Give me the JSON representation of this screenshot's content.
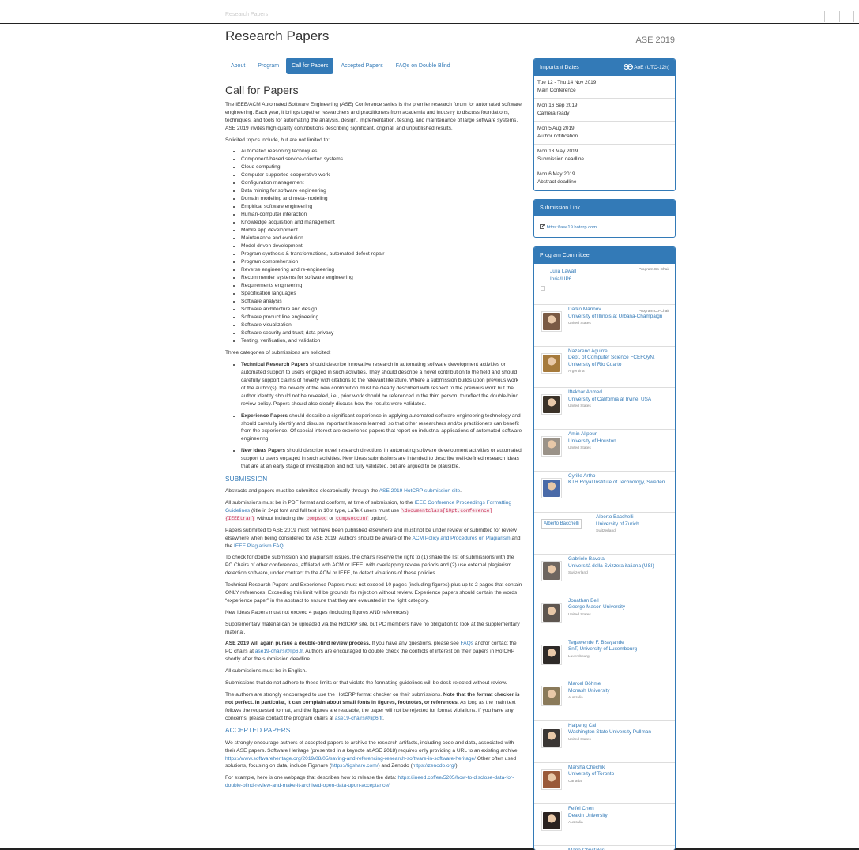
{
  "topbar": {
    "faint_text": "Research Papers"
  },
  "page": {
    "title": "Research Papers",
    "conference": "ASE 2019"
  },
  "tabs": [
    {
      "label": "About",
      "active": false
    },
    {
      "label": "Program",
      "active": false
    },
    {
      "label": "Call for Papers",
      "active": true
    },
    {
      "label": "Accepted Papers",
      "active": false
    },
    {
      "label": "FAQs on Double Blind",
      "active": false
    }
  ],
  "main": {
    "heading": "Call for Papers",
    "intro": "The IEEE/ACM Automated Software Engineering (ASE) Conference series is the premier research forum for automated software engineering. Each year, it brings together researchers and practitioners from academia and industry to discuss foundations, techniques, and tools for automating the analysis, design, implementation, testing, and maintenance of large software systems. ASE 2019 invites high quality contributions describing significant, original, and unpublished results.",
    "topics_intro": "Solicited topics include, but are not limited to:",
    "topics": [
      "Automated reasoning techniques",
      "Component-based service-oriented systems",
      "Cloud computing",
      "Computer-supported cooperative work",
      "Configuration management",
      "Data mining for software engineering",
      "Domain modeling and meta-modeling",
      "Empirical software engineering",
      "Human-computer interaction",
      "Knowledge acquisition and management",
      "Mobile app development",
      "Maintenance and evolution",
      "Model-driven development",
      "Program synthesis & transformations, automated defect repair",
      "Program comprehension",
      "Reverse engineering and re-engineering",
      "Recommender systems for software engineering",
      "Requirements engineering",
      "Specification languages",
      "Software analysis",
      "Software architecture and design",
      "Software product line engineering",
      "Software visualization",
      "Software security and trust; data privacy",
      "Testing, verification, and validation"
    ],
    "categories_intro": "Three categories of submissions are solicited:",
    "categories": [
      {
        "title": "Technical Research Papers",
        "text": " should describe innovative research in automating software development activities or automated support to users engaged in such activities. They should describe a novel contribution to the field and should carefully support claims of novelty with citations to the relevant literature. Where a submission builds upon previous work of the author(s), the novelty of the new contribution must be clearly described with respect to the previous work but the author identity should not be revealed, i.e., prior work should be referenced in the third person, to reflect the double-blind review policy. Papers should also clearly discuss how the results were validated."
      },
      {
        "title": "Experience Papers",
        "text": " should describe a significant experience in applying automated software engineering technology and should carefully identify and discuss important lessons learned, so that other researchers and/or practitioners can benefit from the experience. Of special interest are experience papers that report on industrial applications of automated software engineering."
      },
      {
        "title": "New Ideas Papers",
        "text": " should describe novel research directions in automating software development activities or automated support to users engaged in such activities. New ideas submissions are intended to describe well-defined research ideas that are at an early stage of investigation and not fully validated, but are argued to be plausible."
      }
    ],
    "submission_heading": "SUBMISSION",
    "sub_p1_pre": "Abstracts and papers must be submitted electronically through the ",
    "sub_p1_link": "ASE 2019 HotCRP submission site",
    "sub_p1_post": ".",
    "sub_p2_pre": "All submissions must be in PDF format and conform, at time of submission, to the ",
    "sub_p2_link": "IEEE Conference Proceedings Formatting Guidelines",
    "sub_p2_mid": " (title in 24pt font and full text in 10pt type, LaTeX users must use ",
    "sub_p2_code1": "\\documentclass[10pt,conference]{IEEEtran}",
    "sub_p2_mid2": " without including the ",
    "sub_p2_code2": "compsoc",
    "sub_p2_or": " or ",
    "sub_p2_code3": "compsocconf",
    "sub_p2_post": " option).",
    "sub_p3_pre": "Papers submitted to ASE 2019 must not have been published elsewhere and must not be under review or submitted for review elsewhere when being considered for ASE 2019. Authors should be aware of the ",
    "sub_p3_link1": "ACM Policy and Procedures on Plagiarism",
    "sub_p3_mid": " and the ",
    "sub_p3_link2": "IEEE Plagiarism FAQ",
    "sub_p3_post": ".",
    "sub_p4": "To check for double submission and plagiarism issues, the chairs reserve the right to (1) share the list of submissions with the PC Chairs of other conferences, affiliated with ACM or IEEE, with overlapping review periods and (2) use external plagiarism detection software, under contract to the ACM or IEEE, to detect violations of these policies.",
    "sub_p5": "Technical Research Papers and Experience Papers must not exceed 10 pages (including figures) plus up to 2 pages that contain ONLY references. Exceeding this limit will be grounds for rejection without review. Experience papers should contain the words “experience paper” in the abstract to ensure that they are evaluated in the right category.",
    "sub_p6": "New Ideas Papers must not exceed 4 pages (including figures AND references).",
    "sub_p7": "Supplementary material can be uploaded via the HotCRP site, but PC members have no obligation to look at the supplementary material.",
    "sub_p8_bold": "ASE 2019 will again pursue a double-blind review process.",
    "sub_p8_pre": " If you have any questions, please see ",
    "sub_p8_link1": "FAQs",
    "sub_p8_mid": " and/or contact the PC chairs at ",
    "sub_p8_link2": "ase19-chairs@lip6.fr",
    "sub_p8_post": ". Authors are encouraged to double check the conflicts of interest on their papers in HotCRP shortly after the submission deadline.",
    "sub_p9": "All submissions must be in English.",
    "sub_p10": "Submissions that do not adhere to these limits or that violate the formatting guidelines will be desk-rejected without review.",
    "sub_p11_pre": "The authors are strongly encouraged to use the HotCRP format checker on their submissions. ",
    "sub_p11_bold": "Note that the format checker is not perfect. In particular, it can complain about small fonts in figures, footnotes, or references.",
    "sub_p11_mid": " As long as the main text follows the requested format, and the figures are readable, the paper will not be rejected for format violations. If you have any concerns, please contact the program chairs at ",
    "sub_p11_link": "ase19-chairs@lip6.fr",
    "sub_p11_post": ".",
    "accepted_heading": "ACCEPTED PAPERS",
    "acc_p1_pre": "We strongly encourage authors of accepted papers to archive the research artifacts, including code and data, associated with their ASE papers. Software Heritage (presented in a keynote at ASE 2018) requires only providing a URL to an existing archive: ",
    "acc_p1_link1": "https://www.softwareheritage.org/2019/08/05/saving-and-referencing-research-software-in-software-heritage/",
    "acc_p1_mid": " Other often used solutions, focusing on data, include Figshare (",
    "acc_p1_link2": "https://figshare.com/",
    "acc_p1_mid2": ") and Zenodo (",
    "acc_p1_link3": "https://zenodo.org/",
    "acc_p1_post": ").",
    "acc_p2_pre": "For example, here is one webpage that describes how to release the data: ",
    "acc_p2_link": "https://ineed.coffee/5205/how-to-disclose-data-for-double-blind-review-and-make-it-archived-open-data-upon-acceptance/"
  },
  "dates_panel": {
    "title": "Important Dates",
    "timezone": "AoE (UTC-12h)",
    "icon": "globe-icon",
    "dates": [
      {
        "date": "Tue 12 - Thu 14 Nov 2019",
        "label": "Main Conference"
      },
      {
        "date": "Mon 16 Sep 2019",
        "label": "Camera ready"
      },
      {
        "date": "Mon 5 Aug 2019",
        "label": "Author notification"
      },
      {
        "date": "Mon 13 May 2019",
        "label": "Submission deadline"
      },
      {
        "date": "Mon 6 May 2019",
        "label": "Abstract deadline"
      }
    ]
  },
  "submission_panel": {
    "title": "Submission Link",
    "link": "https://ase19.hotcrp.com",
    "icon": "external-link-icon"
  },
  "pc_panel": {
    "title": "Program Committee",
    "first": {
      "name": "Julia Lawall",
      "affiliation": "Inria/LIP6",
      "role": "Program Co-Chair"
    },
    "members": [
      {
        "name": "Darko Marinov",
        "affiliation": "University of Illinois at Urbana-Champaign",
        "country": "United States",
        "role": "Program Co-Chair",
        "color": "#7a5a44"
      },
      {
        "name": "Nazareno Aguirre",
        "affiliation": "Dept. of Computer Science FCEFQyN, University of Rio Cuarto",
        "country": "Argentina",
        "role": "",
        "color": "#a67a3c"
      },
      {
        "name": "Iftekhar Ahmed",
        "affiliation": "University of California at Irvine, USA",
        "country": "United States",
        "role": "",
        "color": "#3b3228"
      },
      {
        "name": "Amin Alipour",
        "affiliation": "University of Houston",
        "country": "United States",
        "role": "",
        "color": "#9a9288"
      },
      {
        "name": "Cyrille Artho",
        "affiliation": "KTH Royal Institute of Technology, Sweden",
        "country": "",
        "role": "",
        "color": "#4a6aa8"
      },
      {
        "name": "Alberto Bacchelli",
        "affiliation": "University of Zurich",
        "country": "Switzerland",
        "role": "",
        "color": "",
        "alt": "Alberto Bacchelli"
      },
      {
        "name": "Gabriele Bavota",
        "affiliation": "Università della Svizzera italiana (USI)",
        "country": "Switzerland",
        "role": "",
        "color": "#6e6660"
      },
      {
        "name": "Jonathan Bell",
        "affiliation": "George Mason University",
        "country": "United States",
        "role": "",
        "color": "#5e5650"
      },
      {
        "name": "Tegawende F. Bissyande",
        "affiliation": "SnT, University of Luxembourg",
        "country": "Luxembourg",
        "role": "",
        "color": "#2e2a28"
      },
      {
        "name": "Marcel Böhme",
        "affiliation": "Monash University",
        "country": "Australia",
        "role": "",
        "color": "#8a7a5a"
      },
      {
        "name": "Haipeng Cai",
        "affiliation": "Washington State University Pullman",
        "country": "United States",
        "role": "",
        "color": "#3a3634"
      },
      {
        "name": "Marsha Chechik",
        "affiliation": "University of Toronto",
        "country": "Canada",
        "role": "",
        "color": "#9a5a3a"
      },
      {
        "name": "Feifei Chen",
        "affiliation": "Deakin University",
        "country": "Australia",
        "role": "",
        "color": "#2a2220"
      },
      {
        "name": "Maria Christakis",
        "affiliation": "MPI-SWS",
        "country": "Germany",
        "role": "",
        "color": "#6a2a1a"
      }
    ]
  },
  "colors": {
    "accent": "#337ab7",
    "text": "#333333"
  }
}
